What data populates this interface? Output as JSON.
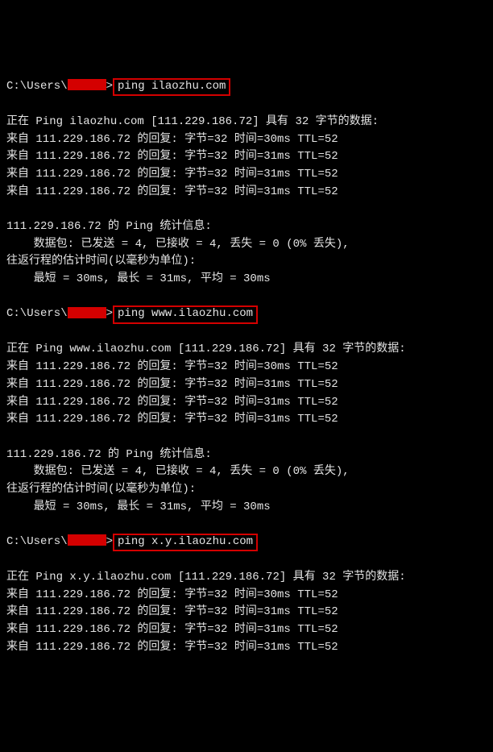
{
  "blocks": [
    {
      "prompt_prefix": "C:\\Users\\",
      "prompt_suffix": ">",
      "command": "ping ilaozhu.com",
      "lines": [
        "",
        "正在 Ping ilaozhu.com [111.229.186.72] 具有 32 字节的数据:",
        "来自 111.229.186.72 的回复: 字节=32 时间=30ms TTL=52",
        "来自 111.229.186.72 的回复: 字节=32 时间=31ms TTL=52",
        "来自 111.229.186.72 的回复: 字节=32 时间=31ms TTL=52",
        "来自 111.229.186.72 的回复: 字节=32 时间=31ms TTL=52",
        "",
        "111.229.186.72 的 Ping 统计信息:",
        "    数据包: 已发送 = 4, 已接收 = 4, 丢失 = 0 (0% 丢失),",
        "往返行程的估计时间(以毫秒为单位):",
        "    最短 = 30ms, 最长 = 31ms, 平均 = 30ms",
        ""
      ]
    },
    {
      "prompt_prefix": "C:\\Users\\",
      "prompt_suffix": ">",
      "command": "ping www.ilaozhu.com",
      "lines": [
        "",
        "正在 Ping www.ilaozhu.com [111.229.186.72] 具有 32 字节的数据:",
        "来自 111.229.186.72 的回复: 字节=32 时间=30ms TTL=52",
        "来自 111.229.186.72 的回复: 字节=32 时间=31ms TTL=52",
        "来自 111.229.186.72 的回复: 字节=32 时间=31ms TTL=52",
        "来自 111.229.186.72 的回复: 字节=32 时间=31ms TTL=52",
        "",
        "111.229.186.72 的 Ping 统计信息:",
        "    数据包: 已发送 = 4, 已接收 = 4, 丢失 = 0 (0% 丢失),",
        "往返行程的估计时间(以毫秒为单位):",
        "    最短 = 30ms, 最长 = 31ms, 平均 = 30ms",
        ""
      ]
    },
    {
      "prompt_prefix": "C:\\Users\\",
      "prompt_suffix": ">",
      "command": "ping x.y.ilaozhu.com",
      "lines": [
        "",
        "正在 Ping x.y.ilaozhu.com [111.229.186.72] 具有 32 字节的数据:",
        "来自 111.229.186.72 的回复: 字节=32 时间=30ms TTL=52",
        "来自 111.229.186.72 的回复: 字节=32 时间=31ms TTL=52",
        "来自 111.229.186.72 的回复: 字节=32 时间=31ms TTL=52",
        "来自 111.229.186.72 的回复: 字节=32 时间=31ms TTL=52"
      ]
    }
  ]
}
